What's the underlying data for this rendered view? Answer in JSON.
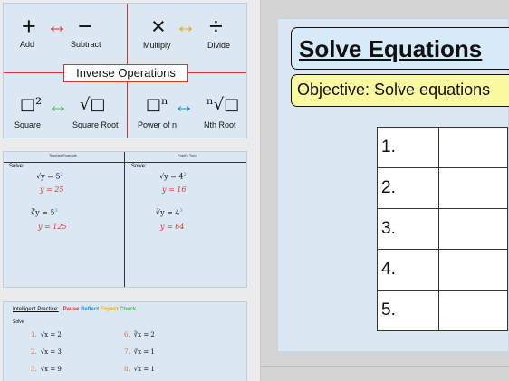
{
  "thumb1": {
    "symbols": {
      "plus": "+",
      "arrow": "↔",
      "minus": "−",
      "times": "×",
      "divide": "÷"
    },
    "add_label": "Add",
    "subtract_label": "Subtract",
    "multiply_label": "Multiply",
    "divide_label": "Divide",
    "inverse_label": "Inverse Operations",
    "square_label": "Square",
    "square_root_label": "Square Root",
    "power_label": "Power of n",
    "nth_root_label": "Nth Root",
    "square_sym": "□²",
    "sqrt_sym": "√□",
    "power_sym": "□ⁿ",
    "nthroot_sym": "ⁿ√□"
  },
  "thumb2": {
    "left_head": "Teacher Example",
    "right_head": "Pupil's Turn",
    "solve_label": "Solve:",
    "left_eq1": "√y = 5",
    "left_ans1": "y = 25",
    "left_eq2": "∛y = 5",
    "left_ans2": "y = 125",
    "right_eq1": "√y = 4",
    "right_ans1": "y = 16",
    "right_eq2": "∛y = 4",
    "right_ans2": "y = 64",
    "sup2": "2",
    "sup3": "3"
  },
  "thumb3": {
    "title": "Intelligent Practice:",
    "pause": "Pause",
    "reflect": "Reflect",
    "expect": "Expect",
    "check": "Check",
    "solve": "Solve",
    "items": [
      {
        "n": "1.",
        "eq": "√x = 2"
      },
      {
        "n": "2.",
        "eq": "√x = 3"
      },
      {
        "n": "3.",
        "eq": "√x = 9"
      },
      {
        "n": "6.",
        "eq": "∛x = 2"
      },
      {
        "n": "7.",
        "eq": "∛x = 1"
      },
      {
        "n": "8.",
        "eq": "√x = 1"
      }
    ]
  },
  "slide": {
    "title": "Solve Equations",
    "objective": "Objective: Solve equations",
    "rows": [
      "1.",
      "2.",
      "3.",
      "4.",
      "5."
    ]
  },
  "colors": {
    "red": "#dd3333",
    "orange": "#f0a818",
    "green": "#5bb85b",
    "blue": "#2a8fd6",
    "slide_bg": "#dbe7f3",
    "objective_bg": "#fafaa0"
  }
}
